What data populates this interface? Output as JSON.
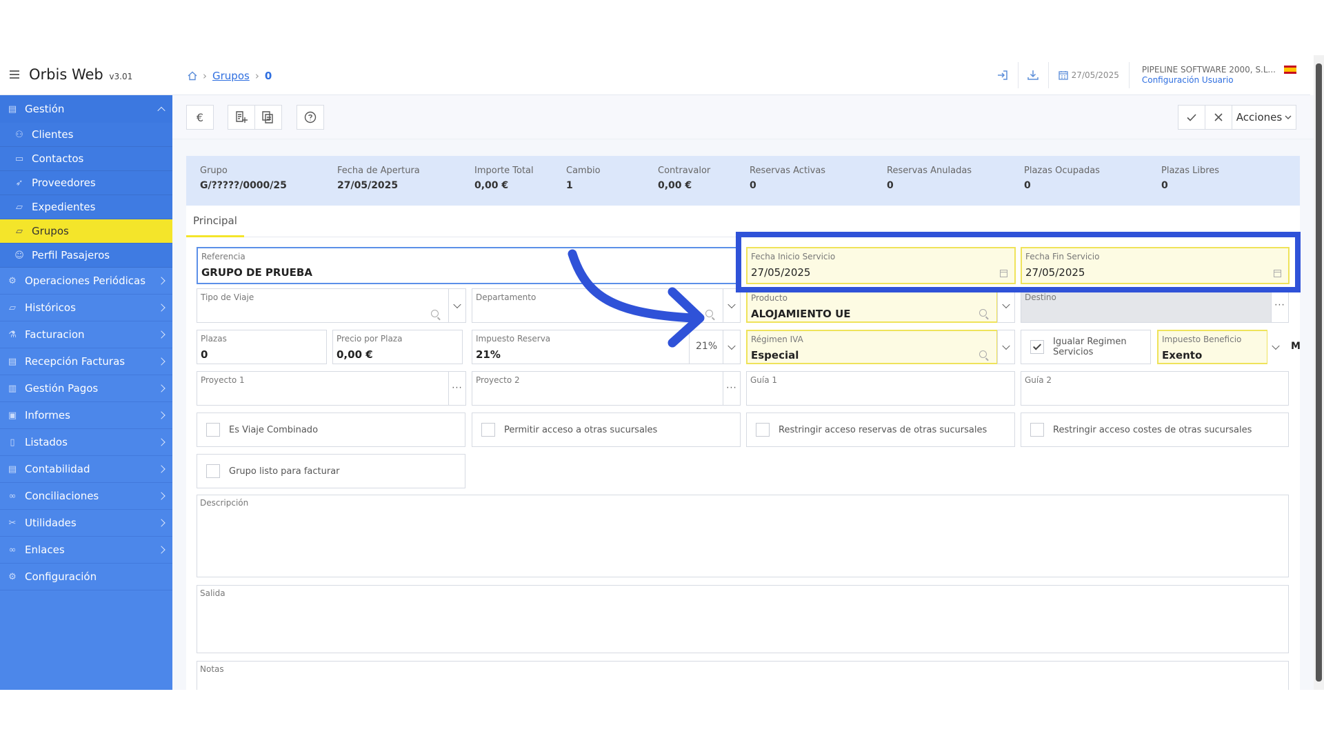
{
  "app": {
    "title": "Orbis Web",
    "version": "v3.01"
  },
  "breadcrumb": {
    "link": "Grupos",
    "current": "0"
  },
  "topbar": {
    "date": "27/05/2025",
    "company": "PIPELINE SOFTWARE 2000, S.L...",
    "config_link": "Configuración Usuario"
  },
  "sidebar": {
    "section": "Gestión",
    "items": [
      {
        "label": "Clientes",
        "icon": "users-icon"
      },
      {
        "label": "Contactos",
        "icon": "contact-card-icon"
      },
      {
        "label": "Proveedores",
        "icon": "rocket-icon"
      },
      {
        "label": "Expedientes",
        "icon": "folder-icon"
      },
      {
        "label": "Grupos",
        "icon": "folder-open-icon",
        "active": true
      },
      {
        "label": "Perfil Pasajeros",
        "icon": "user-icon"
      }
    ],
    "groups": [
      "Operaciones Periódicas",
      "Históricos",
      "Facturacion",
      "Recepción Facturas",
      "Gestión Pagos",
      "Informes",
      "Listados",
      "Contabilidad",
      "Conciliaciones",
      "Utilidades",
      "Enlaces",
      "Configuración"
    ]
  },
  "toolbar": {
    "currency": "€",
    "help": "?",
    "actions": "Acciones"
  },
  "summary": [
    {
      "label": "Grupo",
      "value": "G/?????/0000/25"
    },
    {
      "label": "Fecha de Apertura",
      "value": "27/05/2025"
    },
    {
      "label": "Importe Total",
      "value": "0,00 €"
    },
    {
      "label": "Cambio",
      "value": "1"
    },
    {
      "label": "Contravalor",
      "value": "0,00 €"
    },
    {
      "label": "Reservas Activas",
      "value": "0"
    },
    {
      "label": "Reservas Anuladas",
      "value": "0"
    },
    {
      "label": "Plazas Ocupadas",
      "value": "0"
    },
    {
      "label": "Plazas Libres",
      "value": "0"
    }
  ],
  "tabs": {
    "principal": "Principal"
  },
  "form": {
    "referencia": {
      "label": "Referencia",
      "value": "GRUPO DE PRUEBA"
    },
    "fecha_inicio": {
      "label": "Fecha Inicio Servicio",
      "value": "27/05/2025"
    },
    "fecha_fin": {
      "label": "Fecha Fin Servicio",
      "value": "27/05/2025"
    },
    "tipo_viaje": {
      "label": "Tipo de Viaje",
      "value": ""
    },
    "departamento": {
      "label": "Departamento",
      "value": ""
    },
    "producto": {
      "label": "Producto",
      "value": "ALOJAMIENTO UE"
    },
    "destino": {
      "label": "Destino",
      "value": ""
    },
    "plazas": {
      "label": "Plazas",
      "value": "0"
    },
    "precio_plaza": {
      "label": "Precio por Plaza",
      "value": "0,00 €"
    },
    "impuesto_reserva": {
      "label": "Impuesto Reserva",
      "value": "21%",
      "rate": "21%"
    },
    "regimen_iva": {
      "label": "Régimen IVA",
      "value": "Especial"
    },
    "igualar": {
      "label": "Igualar Regimen Servicios",
      "checked": true
    },
    "impuesto_beneficio": {
      "label": "Impuesto Beneficio",
      "value": "Exento",
      "mode": "M"
    },
    "proyecto1": {
      "label": "Proyecto 1"
    },
    "proyecto2": {
      "label": "Proyecto 2"
    },
    "guia1": {
      "label": "Guía 1"
    },
    "guia2": {
      "label": "Guía 2"
    },
    "checks": [
      "Es Viaje Combinado",
      "Permitir acceso a otras sucursales",
      "Restringir acceso reservas de otras sucursales",
      "Restringir acceso costes de otras sucursales",
      "Grupo listo para facturar"
    ],
    "descripcion": "Descripción",
    "salida": "Salida",
    "notas": "Notas"
  },
  "colors": {
    "sidebar": "#4c87ea",
    "active_item": "#f4e52a",
    "accent": "#2f6fe0",
    "highlight_annotation": "#2f52d8"
  }
}
